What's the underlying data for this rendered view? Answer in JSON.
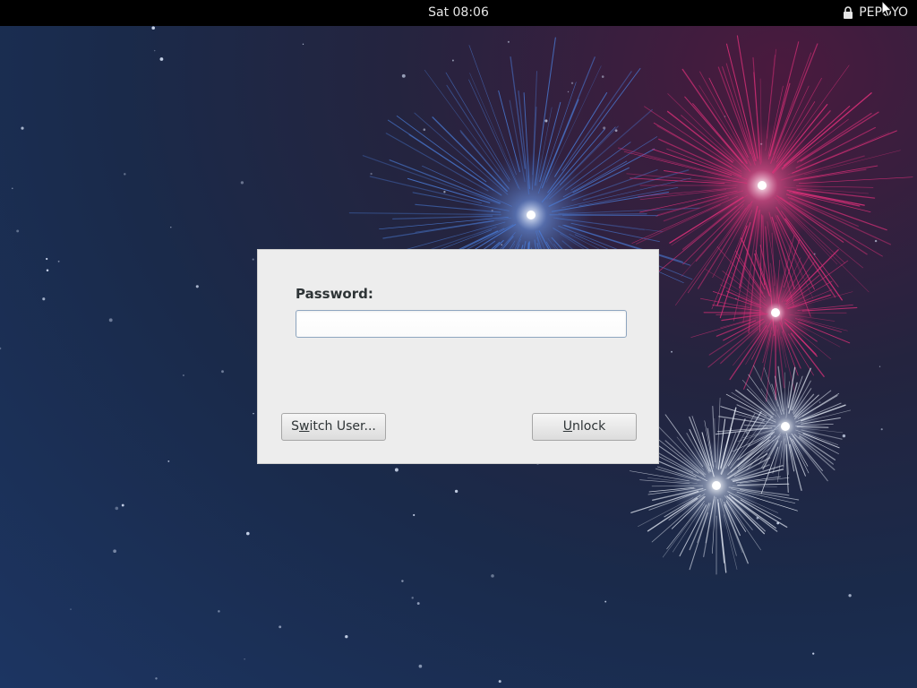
{
  "topbar": {
    "clock": "Sat 08:06",
    "user_name": "PEPOYO",
    "lock_icon": "lock-icon"
  },
  "dialog": {
    "password_label": "Password:",
    "password_value": "",
    "switch_user": {
      "mnemonic": "w",
      "before": "S",
      "after": "itch User..."
    },
    "unlock": {
      "mnemonic": "U",
      "before": "",
      "after": "nlock"
    }
  },
  "colors": {
    "topbar_bg": "#000000",
    "dialog_bg": "#ededed",
    "input_border": "#8fa6c0",
    "firework_blue": "#4a7bd6",
    "firework_pink": "#e0307a",
    "firework_white": "#e8eef8"
  }
}
